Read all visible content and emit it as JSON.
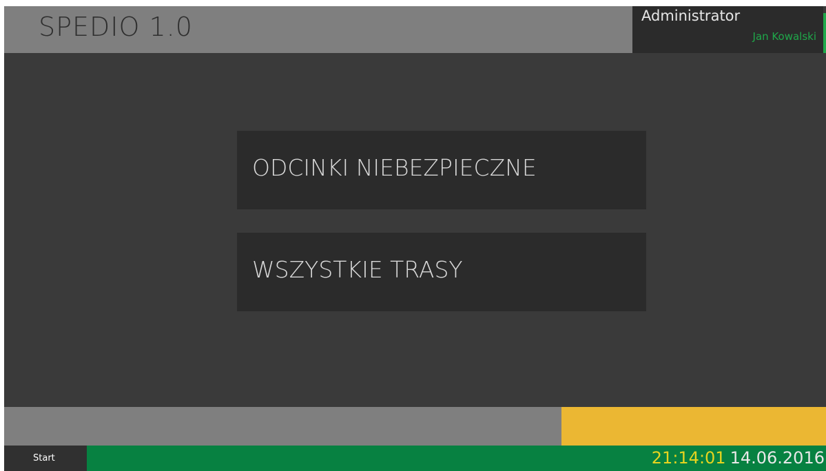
{
  "header": {
    "title": "SPEDIO 1.0"
  },
  "user": {
    "role": "Administrator",
    "name": "Jan Kowalski"
  },
  "menu": {
    "items": [
      {
        "label": "ODCINKI NIEBEZPIECZNE"
      },
      {
        "label": "WSZYSTKIE TRASY"
      }
    ]
  },
  "taskbar": {
    "start_label": "Start",
    "time": "21:14:01",
    "date": "14.06.2016"
  },
  "colors": {
    "header_gray": "#7f7f7f",
    "background": "#3a3a3a",
    "button": "#2b2b2b",
    "accent_green": "#1fa84a",
    "taskbar_green": "#078141",
    "status_yellow": "#ebb733",
    "clock_yellow": "#e6d41f"
  }
}
